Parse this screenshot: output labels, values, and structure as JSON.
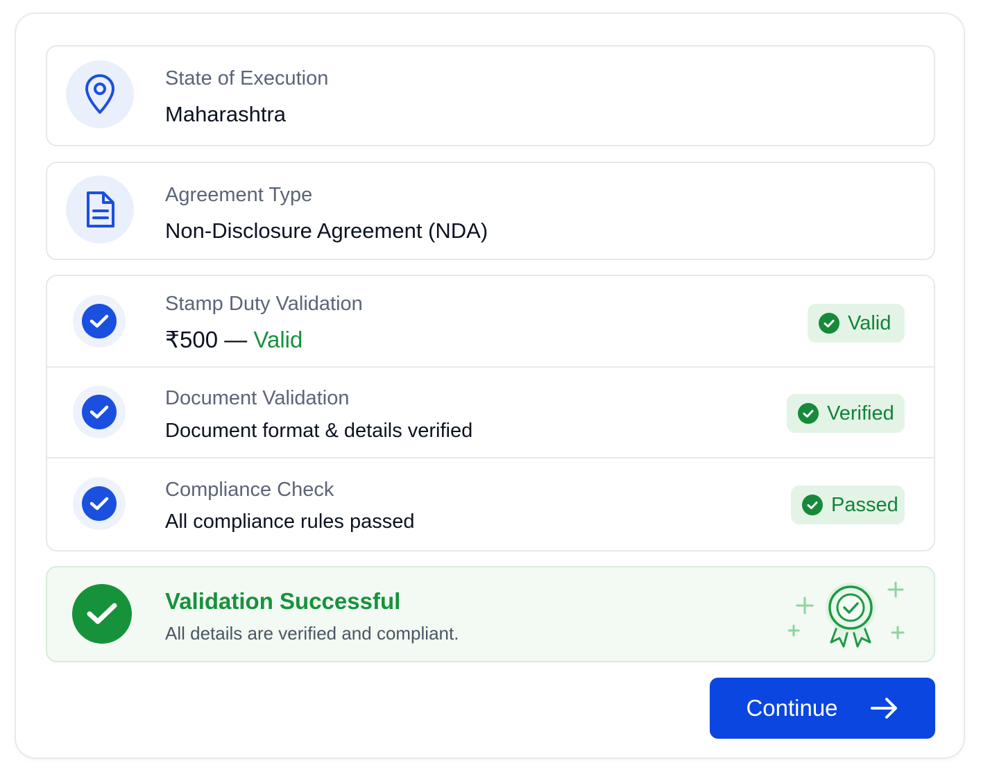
{
  "state": {
    "label": "State of Execution",
    "value": "Maharashtra",
    "icon": "map-pin-icon"
  },
  "agreement": {
    "label": "Agreement Type",
    "value": "Non-Disclosure Agreement (NDA)",
    "icon": "document-icon"
  },
  "checks": [
    {
      "label": "Stamp Duty Validation",
      "value_prefix": "₹500 — ",
      "value_status": "Valid",
      "badge": "Valid"
    },
    {
      "label": "Document Validation",
      "value": "Document format & details verified",
      "badge": "Verified"
    },
    {
      "label": "Compliance Check",
      "value": "All compliance rules passed",
      "badge": "Passed"
    }
  ],
  "success": {
    "title": "Validation Successful",
    "description": "All details are verified and compliant.",
    "icon": "award-ribbon-icon"
  },
  "continue_button": {
    "label": "Continue",
    "icon": "arrow-right-icon"
  },
  "colors": {
    "primary": "#0b46e0",
    "success": "#16923b",
    "badge_bg": "#e3f4e6",
    "icon_bg": "#eaf0fb"
  }
}
